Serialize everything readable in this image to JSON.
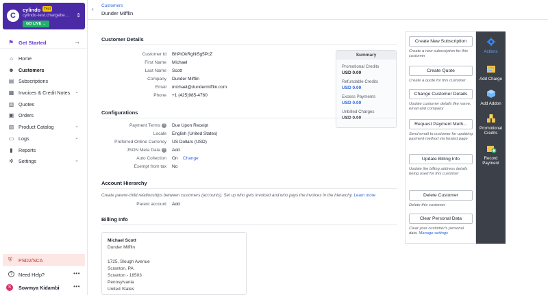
{
  "brand": {
    "name": "cylindo",
    "badge": "Test",
    "site": "cylindo-test.chargebee.com",
    "golive_label": "GO LIVE →",
    "logo_letter": "C"
  },
  "sidebar": {
    "get_started": "Get Started",
    "items": [
      {
        "label": "Home",
        "icon": "home-icon",
        "glyph": "⌂",
        "chevron": false
      },
      {
        "label": "Customers",
        "icon": "customers-icon",
        "glyph": "☻",
        "chevron": false,
        "active": true
      },
      {
        "label": "Subscriptions",
        "icon": "subscriptions-icon",
        "glyph": "▤",
        "chevron": false
      },
      {
        "label": "Invoices & Credit Notes",
        "icon": "invoices-icon",
        "glyph": "▦",
        "chevron": true
      },
      {
        "label": "Quotes",
        "icon": "quotes-icon",
        "glyph": "▥",
        "chevron": false
      },
      {
        "label": "Orders",
        "icon": "orders-icon",
        "glyph": "▣",
        "chevron": false
      },
      {
        "label": "Product Catalog",
        "icon": "catalog-icon",
        "glyph": "▧",
        "chevron": true
      },
      {
        "label": "Logs",
        "icon": "logs-icon",
        "glyph": "▭",
        "chevron": true
      },
      {
        "label": "Reports",
        "icon": "reports-icon",
        "glyph": "▮",
        "chevron": false
      },
      {
        "label": "Settings",
        "icon": "settings-icon",
        "glyph": "✲",
        "chevron": true
      }
    ],
    "psd": "PSD2/SCA",
    "help": "Need Help?",
    "user": "Sowmya Kidambi",
    "user_initial": "S"
  },
  "header": {
    "breadcrumb": "Customers",
    "title": "Dunder Mifflin"
  },
  "customer_details": {
    "title": "Customer Details",
    "fields": [
      {
        "label": "Customer Id",
        "value": "BhPtOkRgNi5g5PcZ"
      },
      {
        "label": "First Name",
        "value": "Michael"
      },
      {
        "label": "Last Name",
        "value": "Scott"
      },
      {
        "label": "Company",
        "value": "Dunder Mifflin"
      },
      {
        "label": "Email",
        "value": "michael@dundermifflin.com"
      },
      {
        "label": "Phone",
        "value": "+1 (425)985-4760"
      }
    ]
  },
  "summary": {
    "title": "Summary",
    "items": [
      {
        "label": "Promotional Credits",
        "value": "USD 0.00",
        "link": false
      },
      {
        "label": "Refundable Credits",
        "value": "USD 0.00",
        "link": true
      },
      {
        "label": "Excess Payments",
        "value": "USD 0.00",
        "link": true
      },
      {
        "label": "Unbilled Charges",
        "value": "USD 0.00",
        "link": false
      }
    ]
  },
  "configurations": {
    "title": "Configurations",
    "payment_terms_label": "Payment Terms",
    "payment_terms": "Due Upon Receipt",
    "locale_label": "Locale",
    "locale": "English (United States)",
    "currency_label": "Preferred Online Currency",
    "currency": "US Dollars (USD)",
    "json_label": "JSON Meta Data",
    "json_action": "Add",
    "auto_collection_label": "Auto Collection",
    "auto_collection": "On",
    "auto_collection_action": "Change",
    "exempt_label": "Exempt from tax",
    "exempt": "No"
  },
  "account_hierarchy": {
    "title": "Account Hierarchy",
    "description": "Create parent-child relationships between customers (accounts): Set up who gets invoiced and who pays the invoices in the hierarchy.",
    "learn_more": "Learn more",
    "parent_label": "Parent account",
    "parent_action": "Add"
  },
  "billing_info": {
    "title": "Billing Info",
    "name": "Michael Scott",
    "company": "Dunder Mifflin",
    "address1": "1725, Slough Avenue",
    "address2": "Scranton, PA",
    "address3": "Scranton - 18503",
    "address4": "Pennsylvania",
    "address5": "United States"
  },
  "actions": {
    "items": [
      {
        "label": "Create New Subscription",
        "desc": "Create a new subscription for this customer"
      },
      {
        "label": "Create Quote",
        "desc": "Create a quote for this customer"
      },
      {
        "label": "Change Customer Details",
        "desc": "Update customer details like name, email and company"
      },
      {
        "label": "Request Payment Meth...",
        "desc": "Send email to customer for updating payment method via hosted page"
      },
      {
        "label": "Update Billing Info",
        "desc": "Update the billing address details being used for this customer"
      },
      {
        "label": "Delete Customer",
        "desc": "Delete this customer"
      },
      {
        "label": "Clear Personal Data",
        "desc": "Clear your customer's personal data.",
        "link": "Manage settings"
      }
    ]
  },
  "rail": {
    "items": [
      {
        "label": "Actions",
        "icon": "gear-icon",
        "active": true
      },
      {
        "label": "Add Charge",
        "icon": "add-charge-icon"
      },
      {
        "label": "Add Addon",
        "icon": "add-addon-icon"
      },
      {
        "label": "Promotional Credits",
        "icon": "promotional-credits-icon"
      },
      {
        "label": "Record Payment",
        "icon": "record-payment-icon"
      }
    ]
  },
  "colors": {
    "brand": "#4b2aa6",
    "link": "#2b66d9",
    "rail": "#3c4048",
    "golive": "#1fb26b"
  }
}
